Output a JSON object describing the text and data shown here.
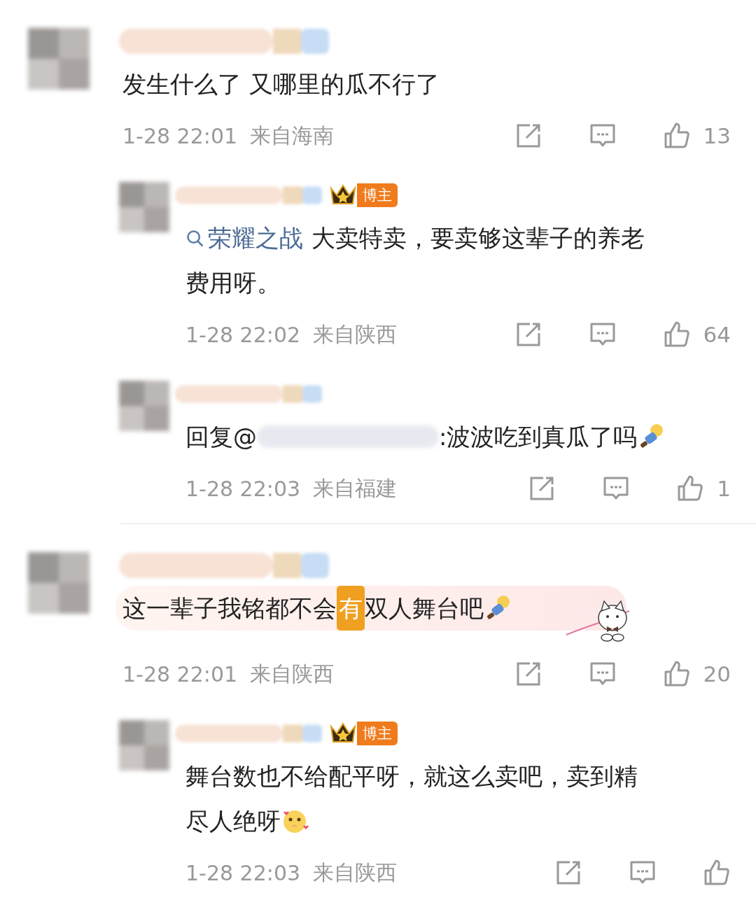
{
  "comments": [
    {
      "kind": "top",
      "bubble": false,
      "lines": [
        [
          {
            "kind": "text",
            "text": "发生什么了 又哪里的瓜不行了"
          }
        ]
      ],
      "time": "1-28 22:01",
      "location": "来自海南",
      "likes": "13"
    },
    {
      "kind": "reply",
      "badge": "博主",
      "bubble": false,
      "lines": [
        [
          {
            "kind": "topic",
            "text": "荣耀之战"
          },
          {
            "kind": "text",
            "text": "大卖特卖，要卖够这辈子的养老"
          }
        ],
        [
          {
            "kind": "text",
            "text": "费用呀。"
          }
        ]
      ],
      "time": "1-28 22:02",
      "location": "来自陕西",
      "likes": "64"
    },
    {
      "kind": "reply",
      "bubble": false,
      "lines": [
        [
          {
            "kind": "text",
            "text": "回复@"
          },
          {
            "kind": "blur"
          },
          {
            "kind": "text",
            "text": ":波波吃到真瓜了吗"
          },
          {
            "kind": "emoji"
          }
        ]
      ],
      "time": "1-28 22:03",
      "location": "来自福建",
      "likes": "1"
    },
    {
      "kind": "top",
      "bubble": true,
      "lines": [
        [
          {
            "kind": "text",
            "text": "这一辈子我铭都不会"
          },
          {
            "kind": "highlight",
            "text": "有"
          },
          {
            "kind": "text",
            "text": "双人舞台吧"
          },
          {
            "kind": "emoji"
          }
        ]
      ],
      "time": "1-28 22:01",
      "location": "来自陕西",
      "likes": "20"
    },
    {
      "kind": "reply",
      "badge": "博主",
      "bubble": false,
      "lines": [
        [
          {
            "kind": "text",
            "text": "舞台数也不给配平呀，就这么卖吧，卖到精"
          }
        ],
        [
          {
            "kind": "text",
            "text": "尽人绝呀"
          },
          {
            "kind": "blush"
          }
        ]
      ],
      "time": "1-28 22:03",
      "location": "来自陕西"
    }
  ]
}
